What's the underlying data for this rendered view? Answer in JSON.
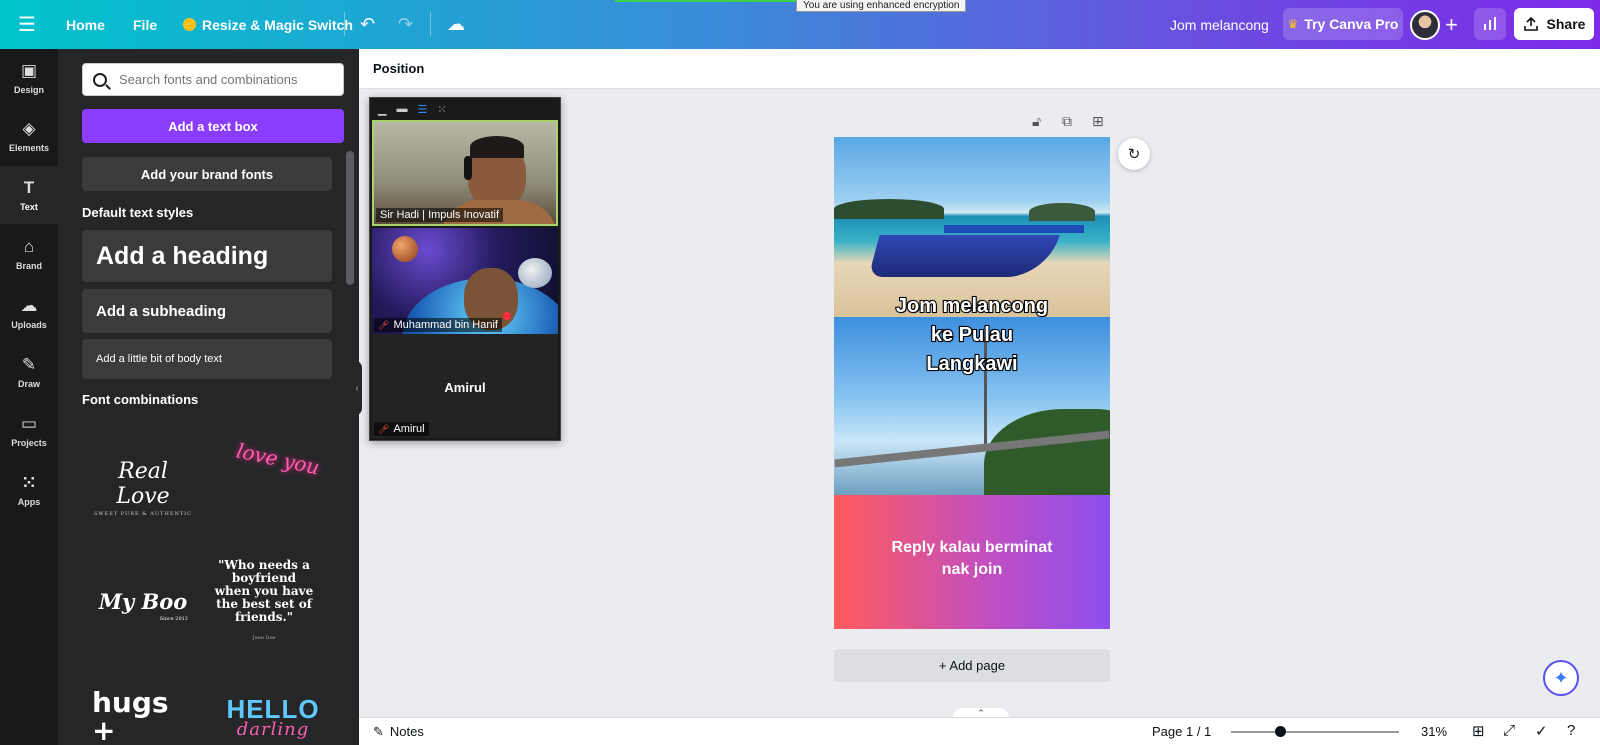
{
  "banner": "You are using enhanced encryption",
  "topbar": {
    "home": "Home",
    "file": "File",
    "resize": "Resize & Magic Switch",
    "doc_name": "Jom melancong",
    "try_pro": "Try Canva Pro",
    "share": "Share"
  },
  "rail": [
    {
      "label": "Design",
      "icon": "layout-icon"
    },
    {
      "label": "Elements",
      "icon": "shapes-icon"
    },
    {
      "label": "Text",
      "icon": "text-icon"
    },
    {
      "label": "Brand",
      "icon": "brand-icon"
    },
    {
      "label": "Uploads",
      "icon": "upload-icon"
    },
    {
      "label": "Draw",
      "icon": "pen-icon"
    },
    {
      "label": "Projects",
      "icon": "folder-icon"
    },
    {
      "label": "Apps",
      "icon": "grid-icon"
    }
  ],
  "panel": {
    "search_placeholder": "Search fonts and combinations",
    "add_text_box": "Add a text box",
    "add_brand_fonts": "Add your brand fonts",
    "default_styles_title": "Default text styles",
    "heading": "Add a heading",
    "subheading": "Add a subheading",
    "body": "Add a little bit of body text",
    "font_combinations_title": "Font combinations",
    "combos": {
      "real_love": "Real Love",
      "real_love_sub": "SWEET PURE & AUTHENTIC",
      "love_you": "love you",
      "my_boo": "My Boo",
      "my_boo_sub": "Since 2012",
      "quote": "\"Who needs a boyfriend when you have the best set of friends.\"",
      "quote_sub": "June Doe",
      "hugs": "hugs + kisses",
      "hello": "HELLO",
      "hello_sub": "darling"
    }
  },
  "position_bar": {
    "label": "Position"
  },
  "zoom_overlay": {
    "participants": [
      {
        "name": "Sir Hadi | Impuls Inovatif"
      },
      {
        "name": "Muhammad bin Hanif"
      },
      {
        "name": "Amirul"
      }
    ],
    "center_name": "Amirul"
  },
  "design": {
    "title_lines": [
      "Jom melancong",
      "ke Pulau",
      "Langkawi"
    ],
    "reply_lines": [
      "Reply kalau berminat",
      "nak join"
    ]
  },
  "add_page": "+ Add page",
  "bottombar": {
    "notes": "Notes",
    "page_indicator": "Page 1 / 1",
    "zoom": "31%",
    "zoom_fraction": 0.31
  },
  "colors": {
    "accent": "#8b3dff",
    "gradient_start": "#ff5b5b",
    "gradient_end": "#8c4ef0"
  }
}
